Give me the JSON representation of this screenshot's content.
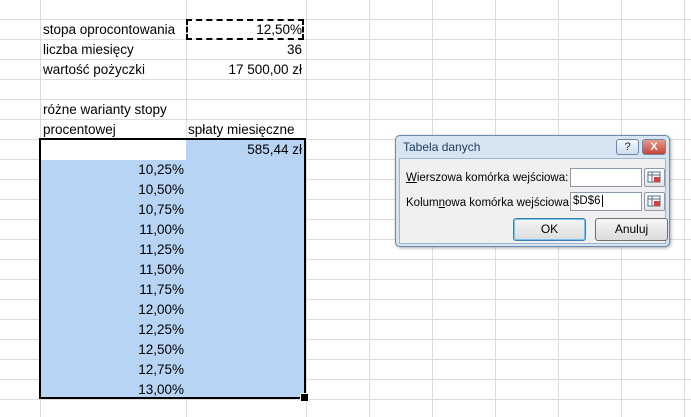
{
  "sheet": {
    "params": [
      {
        "label": "stopa oprocontowania",
        "value": "12,50%"
      },
      {
        "label": "liczba miesięcy",
        "value": "36"
      },
      {
        "label": "wartość pożyczki",
        "value": "17 500,00 zł"
      }
    ],
    "header_line1": "różne warianty stopy",
    "header_line2": "procentowej",
    "header_col2": "spłaty miesięczne",
    "formula_result": "585,44 zł",
    "rates": [
      "10,25%",
      "10,50%",
      "10,75%",
      "11,00%",
      "11,25%",
      "11,50%",
      "11,75%",
      "12,00%",
      "12,25%",
      "12,50%",
      "12,75%",
      "13,00%"
    ],
    "selection_color": "#b8d4f4"
  },
  "dialog": {
    "title": "Tabela danych",
    "help": "?",
    "close": "X",
    "row_label_prefix": "",
    "row_label_hotkey": "W",
    "row_label_rest": "ierszowa komórka wejściowa:",
    "col_label_pre": "Kolum",
    "col_label_hotkey": "n",
    "col_label_rest": "owa komórka wejściowa:",
    "row_value": "",
    "col_value": "$D$6",
    "ok": "OK",
    "cancel": "Anuluj"
  }
}
